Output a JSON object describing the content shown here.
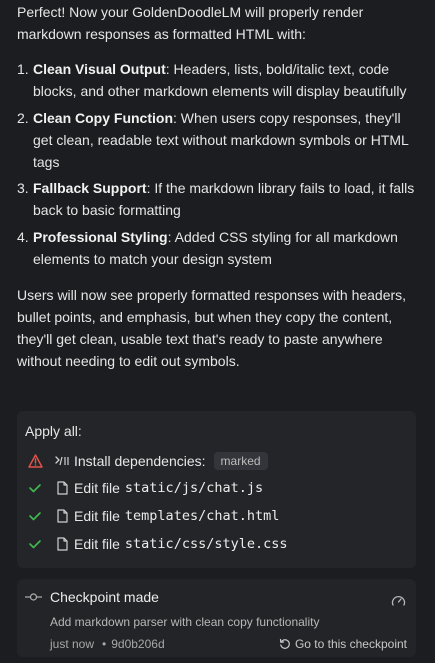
{
  "message": {
    "intro": "Perfect! Now your GoldenDoodleLM will properly render markdown responses as formatted HTML with:",
    "features": [
      {
        "title": "Clean Visual Output",
        "text": ": Headers, lists, bold/italic text, code blocks, and other markdown elements will display beautifully"
      },
      {
        "title": "Clean Copy Function",
        "text": ": When users copy responses, they'll get clean, readable text without markdown symbols or HTML tags"
      },
      {
        "title": "Fallback Support",
        "text": ": If the markdown library fails to load, it falls back to basic formatting"
      },
      {
        "title": "Professional Styling",
        "text": ": Added CSS styling for all markdown elements to match your design system"
      }
    ],
    "summary": "Users will now see properly formatted responses with headers, bullet points, and emphasis, but when they copy the content, they'll get clean, usable text that's ready to paste anywhere without needing to edit out symbols."
  },
  "apply": {
    "title": "Apply all:",
    "install": {
      "label": "Install dependencies:",
      "package": "marked",
      "status_icon": "warning-triangle-icon",
      "status_color": "#e5534b"
    },
    "edit_label": "Edit file",
    "files": [
      {
        "path": "static/js/chat.js",
        "status_icon": "check-icon"
      },
      {
        "path": "templates/chat.html",
        "status_icon": "check-icon"
      },
      {
        "path": "static/css/style.css",
        "status_icon": "check-icon"
      }
    ],
    "check_color": "#3fb950"
  },
  "checkpoint": {
    "title": "Checkpoint made",
    "description": "Add markdown parser with clean copy functionality",
    "time": "just now",
    "separator": "•",
    "hash": "9d0b206d",
    "goto_label": "Go to this checkpoint"
  }
}
